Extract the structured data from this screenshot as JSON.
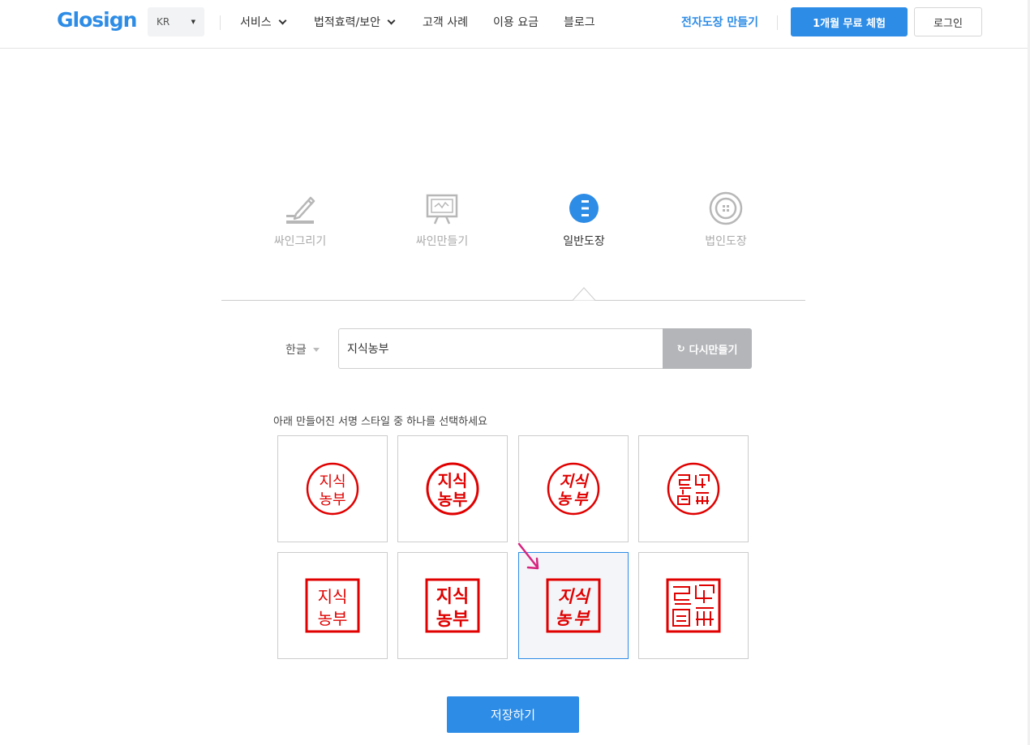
{
  "header": {
    "logo": "Glosign",
    "language": "KR",
    "nav": [
      {
        "label": "서비스"
      },
      {
        "label": "법적효력/보안"
      },
      {
        "label": "고객 사례"
      },
      {
        "label": "이용 요금"
      },
      {
        "label": "블로그"
      }
    ],
    "stamp_link": "전자도장 만들기",
    "trial_button": "1개월 무료 체험",
    "login_button": "로그인"
  },
  "tabs": [
    {
      "label": "싸인그리기",
      "icon": "pen-draw-icon",
      "active": false
    },
    {
      "label": "싸인만들기",
      "icon": "signature-board-icon",
      "active": false
    },
    {
      "label": "일반도장",
      "icon": "general-stamp-icon",
      "active": true
    },
    {
      "label": "법인도장",
      "icon": "corporate-stamp-icon",
      "active": false
    }
  ],
  "form": {
    "script_select": "한글",
    "name_value": "지식농부",
    "regen_button": "다시만들기"
  },
  "instruction": "아래 만들어진 서명 스타일 중 하나를 선택하세요",
  "stamps": [
    {
      "line1": "지식",
      "line2": "농부",
      "shape": "circle",
      "style": "light"
    },
    {
      "line1": "지식",
      "line2": "농부",
      "shape": "circle",
      "style": "bold"
    },
    {
      "line1": "지식",
      "line2": "농부",
      "shape": "circle",
      "style": "brush"
    },
    {
      "line1": "지식",
      "line2": "농부",
      "shape": "circle",
      "style": "seal"
    },
    {
      "line1": "지식",
      "line2": "농부",
      "shape": "square",
      "style": "light"
    },
    {
      "line1": "지식",
      "line2": "농부",
      "shape": "square",
      "style": "bold"
    },
    {
      "line1": "지식",
      "line2": "농부",
      "shape": "square",
      "style": "brush",
      "selected": true
    },
    {
      "line1": "지식",
      "line2": "농부",
      "shape": "square",
      "style": "seal"
    }
  ],
  "save_button": "저장하기",
  "colors": {
    "brand": "#2d8ce6",
    "stamp_red": "#e00000",
    "arrow": "#d6247f",
    "regen_gray": "#b3b5b8"
  }
}
